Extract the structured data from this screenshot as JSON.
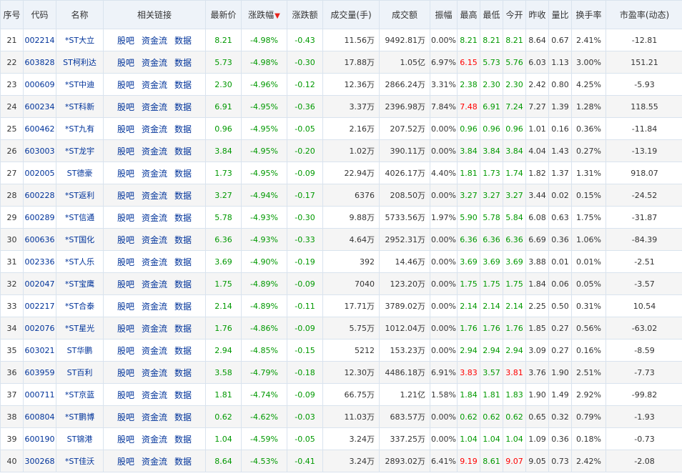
{
  "headers": [
    "序号",
    "代码",
    "名称",
    "相关链接",
    "最新价",
    "涨跌幅",
    "涨跌额",
    "成交量(手)",
    "成交额",
    "振幅",
    "最高",
    "最低",
    "今开",
    "昨收",
    "量比",
    "换手率",
    "市盈率(动态)"
  ],
  "sort_icon": "sort-desc-arrow-icon",
  "links": [
    "股吧",
    "资金流",
    "数据"
  ],
  "colors": {
    "down": "#009900",
    "up": "#ff0000",
    "link": "#00339a",
    "header_bg": "#eef3f9"
  },
  "rows": [
    {
      "no": "21",
      "code": "002214",
      "name": "*ST大立",
      "price": "8.21",
      "pct": "-4.98%",
      "chg": "-0.43",
      "vol": "11.56万",
      "amt": "9492.81万",
      "amp": "0.00%",
      "high": "8.21",
      "low": "8.21",
      "open": "8.21",
      "prev": "8.64",
      "vr": "0.67",
      "turn": "2.41%",
      "pe": "-12.81",
      "hc": "g",
      "lc": "g",
      "oc": "g"
    },
    {
      "no": "22",
      "code": "603828",
      "name": "ST柯利达",
      "price": "5.73",
      "pct": "-4.98%",
      "chg": "-0.30",
      "vol": "17.88万",
      "amt": "1.05亿",
      "amp": "6.97%",
      "high": "6.15",
      "low": "5.73",
      "open": "5.76",
      "prev": "6.03",
      "vr": "1.13",
      "turn": "3.00%",
      "pe": "151.21",
      "hc": "r",
      "lc": "g",
      "oc": "g"
    },
    {
      "no": "23",
      "code": "000609",
      "name": "*ST中迪",
      "price": "2.30",
      "pct": "-4.96%",
      "chg": "-0.12",
      "vol": "12.36万",
      "amt": "2866.24万",
      "amp": "3.31%",
      "high": "2.38",
      "low": "2.30",
      "open": "2.30",
      "prev": "2.42",
      "vr": "0.80",
      "turn": "4.25%",
      "pe": "-5.93",
      "hc": "g",
      "lc": "g",
      "oc": "g"
    },
    {
      "no": "24",
      "code": "600234",
      "name": "*ST科新",
      "price": "6.91",
      "pct": "-4.95%",
      "chg": "-0.36",
      "vol": "3.37万",
      "amt": "2396.98万",
      "amp": "7.84%",
      "high": "7.48",
      "low": "6.91",
      "open": "7.24",
      "prev": "7.27",
      "vr": "1.39",
      "turn": "1.28%",
      "pe": "118.55",
      "hc": "r",
      "lc": "g",
      "oc": "g"
    },
    {
      "no": "25",
      "code": "600462",
      "name": "*ST九有",
      "price": "0.96",
      "pct": "-4.95%",
      "chg": "-0.05",
      "vol": "2.16万",
      "amt": "207.52万",
      "amp": "0.00%",
      "high": "0.96",
      "low": "0.96",
      "open": "0.96",
      "prev": "1.01",
      "vr": "0.16",
      "turn": "0.36%",
      "pe": "-11.84",
      "hc": "g",
      "lc": "g",
      "oc": "g"
    },
    {
      "no": "26",
      "code": "603003",
      "name": "*ST龙宇",
      "price": "3.84",
      "pct": "-4.95%",
      "chg": "-0.20",
      "vol": "1.02万",
      "amt": "390.11万",
      "amp": "0.00%",
      "high": "3.84",
      "low": "3.84",
      "open": "3.84",
      "prev": "4.04",
      "vr": "1.43",
      "turn": "0.27%",
      "pe": "-13.19",
      "hc": "g",
      "lc": "g",
      "oc": "g"
    },
    {
      "no": "27",
      "code": "002005",
      "name": "ST德豪",
      "price": "1.73",
      "pct": "-4.95%",
      "chg": "-0.09",
      "vol": "22.94万",
      "amt": "4026.17万",
      "amp": "4.40%",
      "high": "1.81",
      "low": "1.73",
      "open": "1.74",
      "prev": "1.82",
      "vr": "1.37",
      "turn": "1.31%",
      "pe": "918.07",
      "hc": "g",
      "lc": "g",
      "oc": "g"
    },
    {
      "no": "28",
      "code": "600228",
      "name": "*ST返利",
      "price": "3.27",
      "pct": "-4.94%",
      "chg": "-0.17",
      "vol": "6376",
      "amt": "208.50万",
      "amp": "0.00%",
      "high": "3.27",
      "low": "3.27",
      "open": "3.27",
      "prev": "3.44",
      "vr": "0.02",
      "turn": "0.15%",
      "pe": "-24.52",
      "hc": "g",
      "lc": "g",
      "oc": "g"
    },
    {
      "no": "29",
      "code": "600289",
      "name": "*ST信通",
      "price": "5.78",
      "pct": "-4.93%",
      "chg": "-0.30",
      "vol": "9.88万",
      "amt": "5733.56万",
      "amp": "1.97%",
      "high": "5.90",
      "low": "5.78",
      "open": "5.84",
      "prev": "6.08",
      "vr": "0.63",
      "turn": "1.75%",
      "pe": "-31.87",
      "hc": "g",
      "lc": "g",
      "oc": "g"
    },
    {
      "no": "30",
      "code": "600636",
      "name": "*ST国化",
      "price": "6.36",
      "pct": "-4.93%",
      "chg": "-0.33",
      "vol": "4.64万",
      "amt": "2952.31万",
      "amp": "0.00%",
      "high": "6.36",
      "low": "6.36",
      "open": "6.36",
      "prev": "6.69",
      "vr": "0.36",
      "turn": "1.06%",
      "pe": "-84.39",
      "hc": "g",
      "lc": "g",
      "oc": "g"
    },
    {
      "no": "31",
      "code": "002336",
      "name": "*ST人乐",
      "price": "3.69",
      "pct": "-4.90%",
      "chg": "-0.19",
      "vol": "392",
      "amt": "14.46万",
      "amp": "0.00%",
      "high": "3.69",
      "low": "3.69",
      "open": "3.69",
      "prev": "3.88",
      "vr": "0.01",
      "turn": "0.01%",
      "pe": "-2.51",
      "hc": "g",
      "lc": "g",
      "oc": "g"
    },
    {
      "no": "32",
      "code": "002047",
      "name": "*ST宝鹰",
      "price": "1.75",
      "pct": "-4.89%",
      "chg": "-0.09",
      "vol": "7040",
      "amt": "123.20万",
      "amp": "0.00%",
      "high": "1.75",
      "low": "1.75",
      "open": "1.75",
      "prev": "1.84",
      "vr": "0.06",
      "turn": "0.05%",
      "pe": "-3.57",
      "hc": "g",
      "lc": "g",
      "oc": "g"
    },
    {
      "no": "33",
      "code": "002217",
      "name": "*ST合泰",
      "price": "2.14",
      "pct": "-4.89%",
      "chg": "-0.11",
      "vol": "17.71万",
      "amt": "3789.02万",
      "amp": "0.00%",
      "high": "2.14",
      "low": "2.14",
      "open": "2.14",
      "prev": "2.25",
      "vr": "0.50",
      "turn": "0.31%",
      "pe": "10.54",
      "hc": "g",
      "lc": "g",
      "oc": "g"
    },
    {
      "no": "34",
      "code": "002076",
      "name": "*ST星光",
      "price": "1.76",
      "pct": "-4.86%",
      "chg": "-0.09",
      "vol": "5.75万",
      "amt": "1012.04万",
      "amp": "0.00%",
      "high": "1.76",
      "low": "1.76",
      "open": "1.76",
      "prev": "1.85",
      "vr": "0.27",
      "turn": "0.56%",
      "pe": "-63.02",
      "hc": "g",
      "lc": "g",
      "oc": "g"
    },
    {
      "no": "35",
      "code": "603021",
      "name": "ST华鹏",
      "price": "2.94",
      "pct": "-4.85%",
      "chg": "-0.15",
      "vol": "5212",
      "amt": "153.23万",
      "amp": "0.00%",
      "high": "2.94",
      "low": "2.94",
      "open": "2.94",
      "prev": "3.09",
      "vr": "0.27",
      "turn": "0.16%",
      "pe": "-8.59",
      "hc": "g",
      "lc": "g",
      "oc": "g"
    },
    {
      "no": "36",
      "code": "603959",
      "name": "ST百利",
      "price": "3.58",
      "pct": "-4.79%",
      "chg": "-0.18",
      "vol": "12.30万",
      "amt": "4486.18万",
      "amp": "6.91%",
      "high": "3.83",
      "low": "3.57",
      "open": "3.81",
      "prev": "3.76",
      "vr": "1.90",
      "turn": "2.51%",
      "pe": "-7.73",
      "hc": "r",
      "lc": "g",
      "oc": "r"
    },
    {
      "no": "37",
      "code": "000711",
      "name": "*ST京蓝",
      "price": "1.81",
      "pct": "-4.74%",
      "chg": "-0.09",
      "vol": "66.75万",
      "amt": "1.21亿",
      "amp": "1.58%",
      "high": "1.84",
      "low": "1.81",
      "open": "1.83",
      "prev": "1.90",
      "vr": "1.49",
      "turn": "2.92%",
      "pe": "-99.82",
      "hc": "g",
      "lc": "g",
      "oc": "g"
    },
    {
      "no": "38",
      "code": "600804",
      "name": "*ST鹏博",
      "price": "0.62",
      "pct": "-4.62%",
      "chg": "-0.03",
      "vol": "11.03万",
      "amt": "683.57万",
      "amp": "0.00%",
      "high": "0.62",
      "low": "0.62",
      "open": "0.62",
      "prev": "0.65",
      "vr": "0.32",
      "turn": "0.79%",
      "pe": "-1.93",
      "hc": "g",
      "lc": "g",
      "oc": "g"
    },
    {
      "no": "39",
      "code": "600190",
      "name": "ST锦港",
      "price": "1.04",
      "pct": "-4.59%",
      "chg": "-0.05",
      "vol": "3.24万",
      "amt": "337.25万",
      "amp": "0.00%",
      "high": "1.04",
      "low": "1.04",
      "open": "1.04",
      "prev": "1.09",
      "vr": "0.36",
      "turn": "0.18%",
      "pe": "-0.73",
      "hc": "g",
      "lc": "g",
      "oc": "g"
    },
    {
      "no": "40",
      "code": "300268",
      "name": "*ST佳沃",
      "price": "8.64",
      "pct": "-4.53%",
      "chg": "-0.41",
      "vol": "3.24万",
      "amt": "2893.02万",
      "amp": "6.41%",
      "high": "9.19",
      "low": "8.61",
      "open": "9.07",
      "prev": "9.05",
      "vr": "0.73",
      "turn": "2.42%",
      "pe": "-2.08",
      "hc": "r",
      "lc": "g",
      "oc": "r"
    }
  ]
}
